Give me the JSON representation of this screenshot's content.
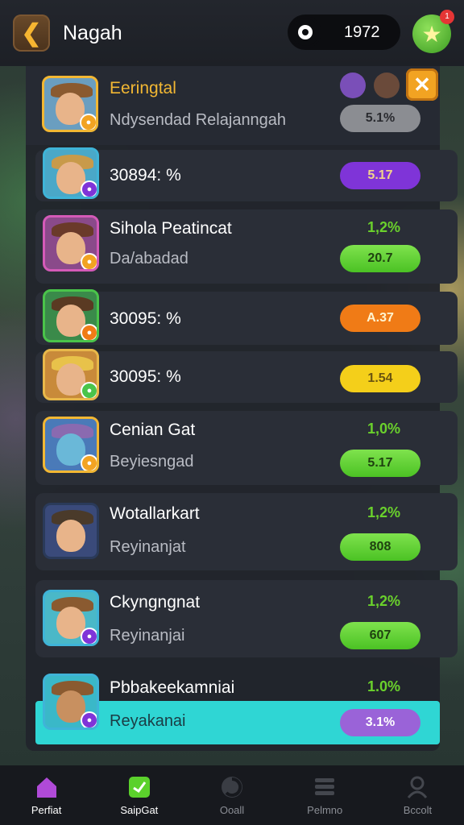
{
  "header": {
    "back_icon": "chevron-left-icon",
    "title": "Nagah",
    "currency_icon": "coin-icon",
    "currency_amount": "1972",
    "star_icon": "star-icon",
    "notification_count": "1"
  },
  "list": {
    "top": {
      "name": "Eeringtal",
      "subtitle": "Ndysendad Relajanngah",
      "value": "5.1%",
      "close_icon": "close-icon"
    },
    "rows": [
      {
        "name": "30894: %",
        "subtitle": "",
        "pct": "",
        "value": "5.17",
        "pill_color": "#7f34d8"
      },
      {
        "name": "Sihola Peatincat",
        "subtitle": "Da/abadad",
        "pct": "1,2%",
        "value": "20.7",
        "pill_color": "#5bd12c"
      },
      {
        "name": "30095: %",
        "subtitle": "",
        "pct": "",
        "value": "A.37",
        "pill_color": "#f07b16"
      },
      {
        "name": "30095: %",
        "subtitle": "",
        "pct": "",
        "value": "1.54",
        "pill_color": "#f4cf1a"
      },
      {
        "name": "Cenian Gat",
        "subtitle": "Beyiesngad",
        "pct": "1,0%",
        "value": "5.17",
        "pill_color": "#5bd12c"
      },
      {
        "name": "Wotallarkart",
        "subtitle": "Reyinanjat",
        "pct": "1,2%",
        "value": "808",
        "pill_color": "#5bd12c"
      },
      {
        "name": "Ckyngngnat",
        "subtitle": "Reyinanjai",
        "pct": "1,2%",
        "value": "607",
        "pill_color": "#5bd12c"
      },
      {
        "name": "Pbbakeekamniai",
        "subtitle": "Reyakanai",
        "pct": "1.0%",
        "value": "3.1%",
        "pill_color": "#9a63d8"
      }
    ]
  },
  "nav": {
    "items": [
      {
        "label": "Perfiat",
        "icon": "home-icon"
      },
      {
        "label": "SaipGat",
        "icon": "chat-icon"
      },
      {
        "label": "Ooall",
        "icon": "swirl-icon"
      },
      {
        "label": "Pelmno",
        "icon": "menu-icon"
      },
      {
        "label": "Bccolt",
        "icon": "profile-icon"
      }
    ]
  }
}
